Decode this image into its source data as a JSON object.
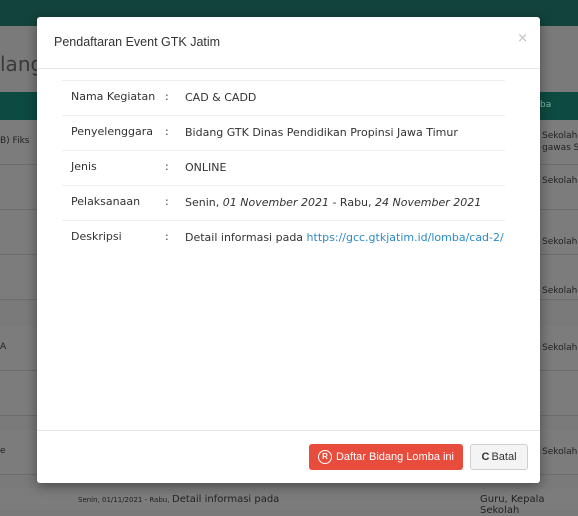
{
  "background": {
    "page_title_fragment": "lang",
    "header_right": "ba",
    "rows": [
      {
        "left": "B) Fiks",
        "right": "Sekolah\ngawas S"
      },
      {
        "left": "",
        "right": "Sekolah"
      },
      {
        "left": "",
        "right": "Sekolah"
      },
      {
        "left": "",
        "right": "Sekolah"
      },
      {
        "left": "A",
        "right": "Sekolah"
      },
      {
        "left": "",
        "right": ""
      },
      {
        "left": "e",
        "right": "Sekolah"
      }
    ],
    "bottom_row": {
      "date": "Senin, 01/11/2021 - Rabu,",
      "desc": "Detail informasi pada",
      "right": "Guru, Kepala Sekolah"
    }
  },
  "modal": {
    "title": "Pendaftaran Event GTK Jatim",
    "close_label": "×",
    "separator": ":",
    "fields": {
      "nama_label": "Nama Kegiatan",
      "nama_value": "CAD & CADD",
      "penyelenggara_label": "Penyelenggara",
      "penyelenggara_value": "Bidang GTK Dinas Pendidikan Propinsi Jawa Timur",
      "jenis_label": "Jenis",
      "jenis_value": "ONLINE",
      "pelaksanaan_label": "Pelaksanaan",
      "pelaksanaan_start_day": "Senin,",
      "pelaksanaan_start_date": "01 November 2021",
      "pelaksanaan_dash": "- Rabu,",
      "pelaksanaan_end_date": "24 November 2021",
      "deskripsi_label": "Deskripsi",
      "deskripsi_text": "Detail informasi pada",
      "deskripsi_link": "https://gcc.gtkjatim.id/lomba/cad-2/"
    },
    "buttons": {
      "daftar_icon": "R",
      "daftar_label": "Daftar Bidang Lomba ini",
      "batal_icon": "C",
      "batal_label": "Batal"
    }
  },
  "colors": {
    "accent_red": "#e74c3c",
    "link_blue": "#2a8ac6",
    "header_dark_green": "#0d4a41"
  }
}
